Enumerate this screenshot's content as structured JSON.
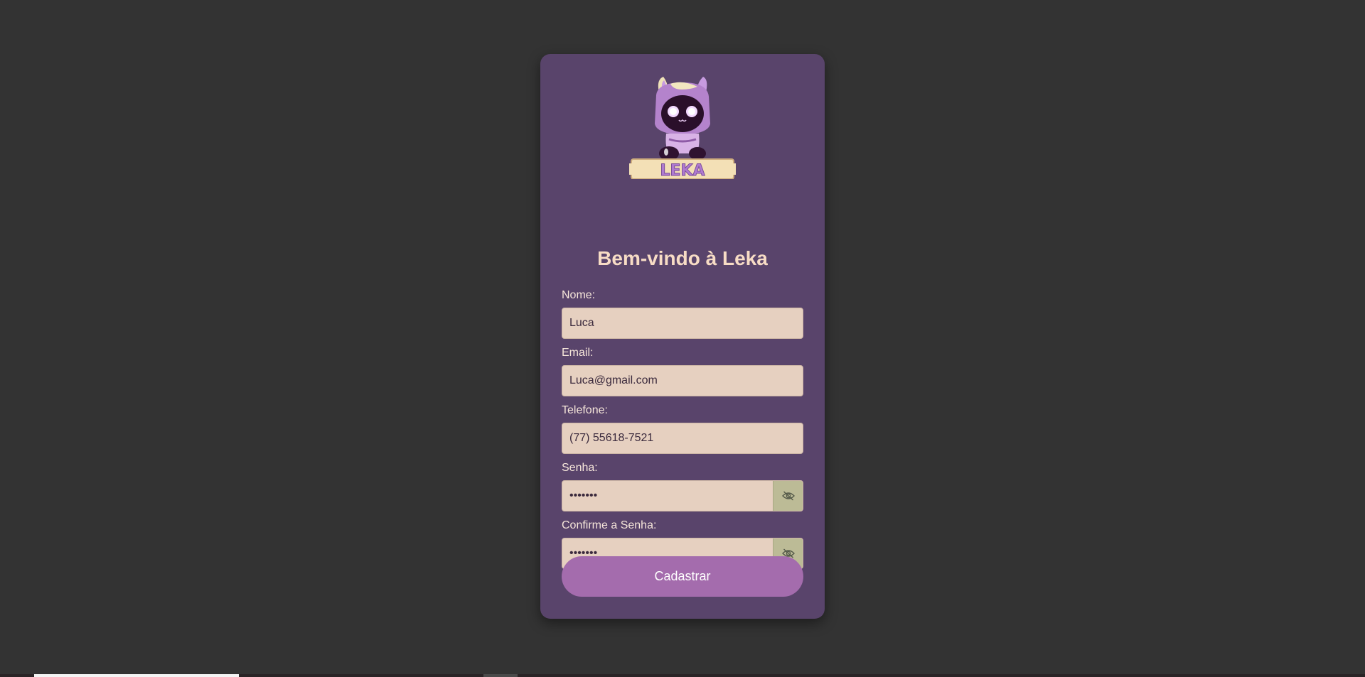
{
  "brand": {
    "logo_text": "LEKA"
  },
  "title": "Bem-vindo à Leka",
  "form": {
    "name_label": "Nome:",
    "name_value": "Luca",
    "email_label": "Email:",
    "email_value": "Luca@gmail.com",
    "phone_label": "Telefone:",
    "phone_value": "(77) 55618-7521",
    "password_label": "Senha:",
    "password_value": "1234567",
    "confirm_label": "Confirme a Senha:",
    "confirm_value": "1234567",
    "toggle_icon": "eye-off-icon"
  },
  "submit_label": "Cadastrar",
  "colors": {
    "background": "#333333",
    "card": "#59446b",
    "title": "#f7dcc5",
    "input_bg": "#e6d0c0",
    "toggle_bg": "#bcbb96",
    "button": "#a46cad"
  }
}
